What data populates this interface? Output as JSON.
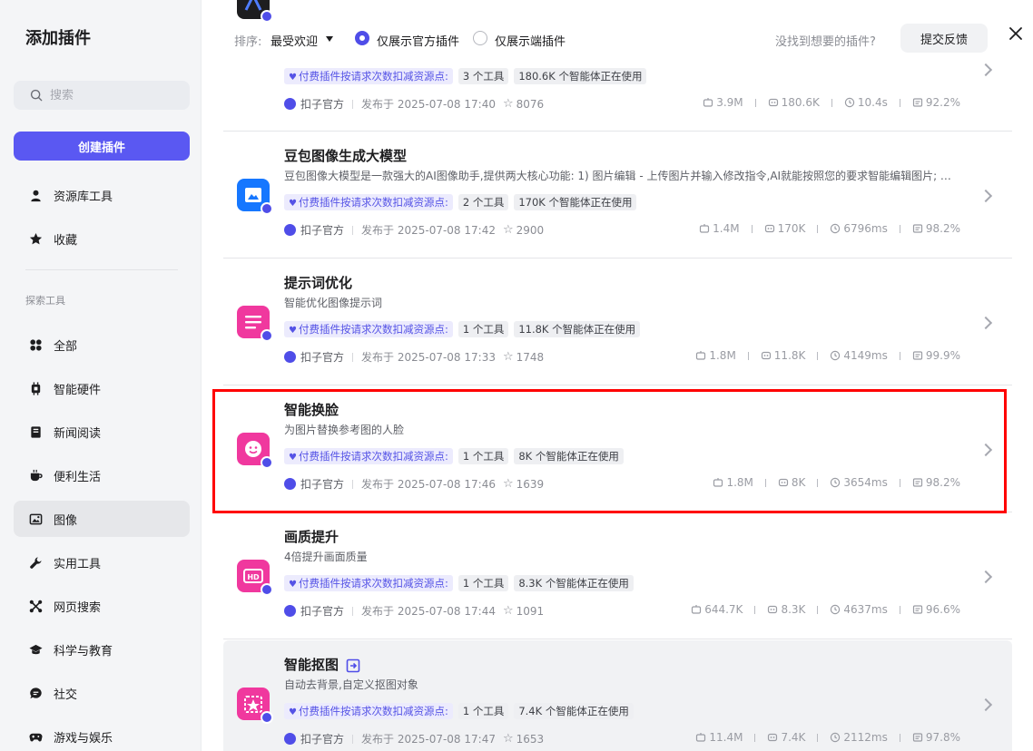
{
  "sidebar": {
    "title": "添加插件",
    "search_placeholder": "搜索",
    "create_button": "创建插件",
    "top_items": [
      {
        "label": "资源库工具",
        "icon": "user-icon"
      },
      {
        "label": "收藏",
        "icon": "star-icon"
      }
    ],
    "section_label": "探索工具",
    "items": [
      {
        "label": "全部",
        "icon": "grid-icon"
      },
      {
        "label": "智能硬件",
        "icon": "chip-icon"
      },
      {
        "label": "新闻阅读",
        "icon": "book-icon"
      },
      {
        "label": "便利生活",
        "icon": "coffee-icon"
      },
      {
        "label": "图像",
        "icon": "image-icon",
        "active": true
      },
      {
        "label": "实用工具",
        "icon": "wrench-icon"
      },
      {
        "label": "网页搜索",
        "icon": "network-icon"
      },
      {
        "label": "科学与教育",
        "icon": "graduation-cap-icon"
      },
      {
        "label": "社交",
        "icon": "chat-bubble-icon"
      },
      {
        "label": "游戏与娱乐",
        "icon": "gamepad-icon"
      }
    ]
  },
  "topbar": {
    "sort_label": "排序:",
    "sort_value": "最受欢迎",
    "radio_official": "仅展示官方插件",
    "radio_endpoint": "仅展示端插件",
    "hint": "没找到想要的插件?",
    "feedback_button": "提交反馈"
  },
  "plugins": [
    {
      "title": "",
      "description": "",
      "tags": [
        "付费插件按请求次数扣减资源点:",
        "3 个工具",
        "180.6K 个智能体正在使用"
      ],
      "author": "扣子官方",
      "published": "发布于 2025-07-08 17:40",
      "stars": "8076",
      "stats": [
        "3.9M",
        "180.6K",
        "10.4s",
        "92.2%"
      ],
      "logo_color": "#1d1d1f"
    },
    {
      "title": "豆包图像生成大模型",
      "description": "豆包图像大模型是一款强大的AI图像助手,提供两大核心功能: 1) 图片编辑 - 上传图片并输入修改指令,AI就能按照您的要求智能编辑图片; …",
      "tags": [
        "付费插件按请求次数扣减资源点:",
        "2 个工具",
        "170K 个智能体正在使用"
      ],
      "author": "扣子官方",
      "published": "发布于 2025-07-08 17:42",
      "stars": "2900",
      "stats": [
        "1.4M",
        "170K",
        "6796ms",
        "98.2%"
      ],
      "logo_color": "#1677ff"
    },
    {
      "title": "提示词优化",
      "description": "智能优化图像提示词",
      "tags": [
        "付费插件按请求次数扣减资源点:",
        "1 个工具",
        "11.8K 个智能体正在使用"
      ],
      "author": "扣子官方",
      "published": "发布于 2025-07-08 17:33",
      "stars": "1748",
      "stats": [
        "1.8M",
        "11.8K",
        "4149ms",
        "99.9%"
      ],
      "logo_color": "#f0389e"
    },
    {
      "title": "智能换脸",
      "description": "为图片替换参考图的人脸",
      "tags": [
        "付费插件按请求次数扣减资源点:",
        "1 个工具",
        "8K 个智能体正在使用"
      ],
      "author": "扣子官方",
      "published": "发布于 2025-07-08 17:46",
      "stars": "1639",
      "stats": [
        "1.8M",
        "8K",
        "3654ms",
        "98.2%"
      ],
      "logo_color": "#f0389e"
    },
    {
      "title": "画质提升",
      "description": "4倍提升画面质量",
      "tags": [
        "付费插件按请求次数扣减资源点:",
        "1 个工具",
        "8.3K 个智能体正在使用"
      ],
      "author": "扣子官方",
      "published": "发布于 2025-07-08 17:44",
      "stars": "1091",
      "stats": [
        "644.7K",
        "8.3K",
        "4637ms",
        "96.6%"
      ],
      "logo_color": "#f0389e"
    },
    {
      "title": "智能抠图",
      "description": "自动去背景,自定义抠图对象",
      "tags": [
        "付费插件按请求次数扣减资源点:",
        "1 个工具",
        "7.4K 个智能体正在使用"
      ],
      "author": "扣子官方",
      "published": "发布于 2025-07-08 17:47",
      "stars": "1653",
      "stats": [
        "11.4M",
        "7.4K",
        "2112ms",
        "97.8%"
      ],
      "logo_color": "#f0389e"
    }
  ],
  "colors": {
    "accent": "#5a58f2",
    "highlight_border": "#ff0000",
    "paid_tag_bg": "#ecebfd"
  }
}
